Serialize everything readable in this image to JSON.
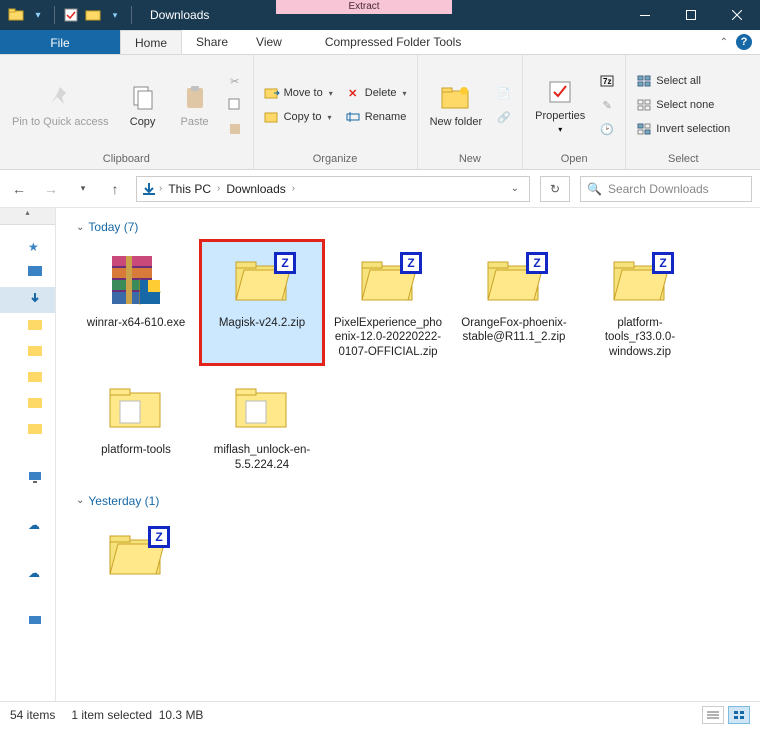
{
  "window": {
    "title": "Downloads"
  },
  "context_tab": {
    "label": "Extract",
    "tools": "Compressed Folder Tools"
  },
  "tabs": {
    "file": "File",
    "home": "Home",
    "share": "Share",
    "view": "View"
  },
  "ribbon": {
    "clipboard": {
      "label": "Clipboard",
      "pin": "Pin to Quick access",
      "copy": "Copy",
      "paste": "Paste"
    },
    "organize": {
      "label": "Organize",
      "move_to": "Move to",
      "copy_to": "Copy to",
      "delete": "Delete",
      "rename": "Rename"
    },
    "new": {
      "label": "New",
      "new_folder": "New folder"
    },
    "open": {
      "label": "Open",
      "properties": "Properties"
    },
    "select": {
      "label": "Select",
      "select_all": "Select all",
      "select_none": "Select none",
      "invert": "Invert selection"
    }
  },
  "breadcrumb": {
    "parts": [
      "This PC",
      "Downloads"
    ]
  },
  "search": {
    "placeholder": "Search Downloads"
  },
  "groups": [
    {
      "name": "Today",
      "count": 7,
      "files": [
        {
          "name": "winrar-x64-610.exe",
          "type": "exe-rar"
        },
        {
          "name": "Magisk-v24.2.zip",
          "type": "zip",
          "selected": true,
          "highlighted": true
        },
        {
          "name": "PixelExperience_phoenix-12.0-20220222-0107-OFFICIAL.zip",
          "type": "zip"
        },
        {
          "name": "OrangeFox-phoenix-stable@R11.1_2.zip",
          "type": "zip"
        },
        {
          "name": "platform-tools_r33.0.0-windows.zip",
          "type": "zip"
        },
        {
          "name": "platform-tools",
          "type": "folder"
        },
        {
          "name": "miflash_unlock-en-5.5.224.24",
          "type": "folder"
        }
      ]
    },
    {
      "name": "Yesterday",
      "count": 1,
      "files": [
        {
          "name": "",
          "type": "zip"
        }
      ]
    }
  ],
  "status": {
    "items": "54 items",
    "selected": "1 item selected",
    "size": "10.3 MB"
  }
}
